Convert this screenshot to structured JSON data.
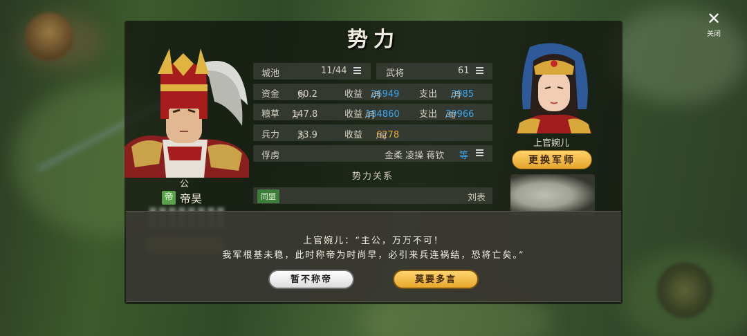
{
  "title": "势力",
  "close": {
    "label": "关闭"
  },
  "ruler": {
    "rank": "公",
    "tag": "帝",
    "name": "帝昊"
  },
  "stats": {
    "cities": {
      "label": "城池",
      "value": "11/44"
    },
    "generals": {
      "label": "武将",
      "value": "61"
    },
    "funds": {
      "label": "资金",
      "value": "60.2",
      "unit": "万",
      "income_label": "收益",
      "income": "26949",
      "income_unit": "/月",
      "expense_label": "支出",
      "expense": "3985",
      "expense_unit": "/月"
    },
    "food": {
      "label": "粮草",
      "value": "147.8",
      "unit": "万",
      "income_label": "收益",
      "income": "184860",
      "income_unit": "/月",
      "expense_label": "支出",
      "expense": "39966",
      "expense_unit": "/旬"
    },
    "troops": {
      "label": "兵力",
      "value": "33.9",
      "unit": "万",
      "income_label": "收益",
      "income": "6278",
      "income_unit": "/旬"
    },
    "captives": {
      "label": "俘虏",
      "names": "金柔 凌操 蒋钦",
      "more": "等"
    }
  },
  "relations": {
    "title": "势力关系",
    "rows": [
      {
        "tag": "同盟",
        "name": "刘表"
      }
    ]
  },
  "advisor": {
    "name": "上官婉儿",
    "change_button": "更换军师"
  },
  "dialog": {
    "line1": "上官婉儿：“主公，万万不可！",
    "line2": "我军根基未稳，此时称帝为时尚早，必引来兵连祸结，恐将亡矣。”",
    "cancel_button": "暂不称帝",
    "confirm_button": "莫要多言"
  },
  "colors": {
    "income_blue": "#3aa6f0",
    "troop_orange": "#e3a93a",
    "gold_button": "#e7a82b"
  }
}
